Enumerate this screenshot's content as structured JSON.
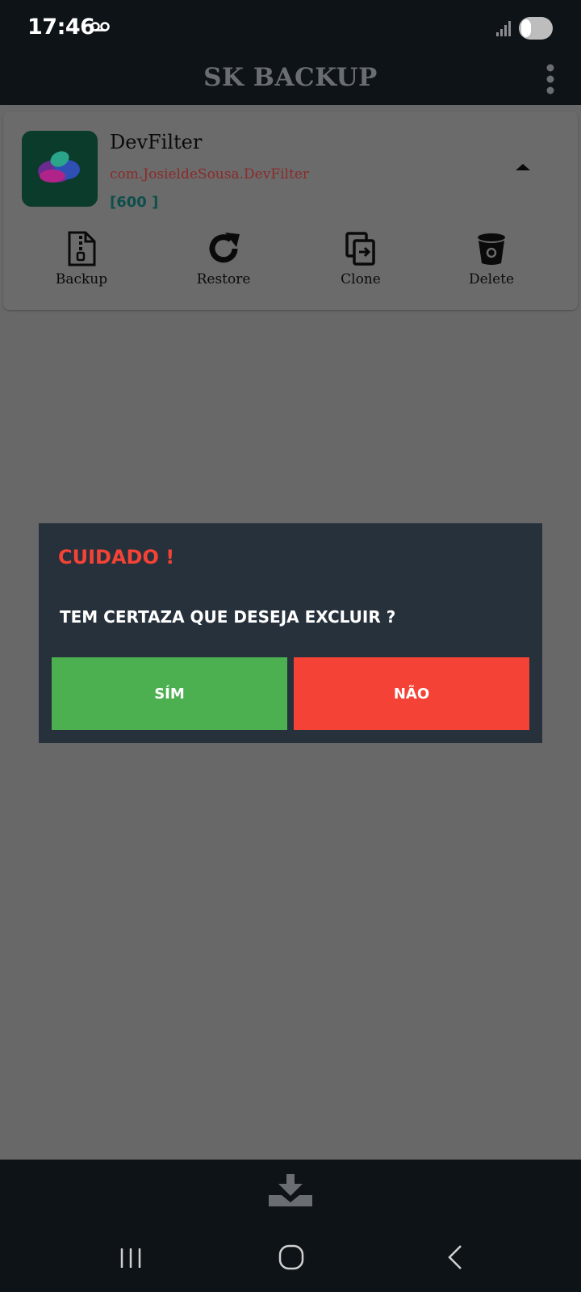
{
  "status_bar": {
    "time": "17:46",
    "icons": [
      "voicemail-icon",
      "signal-icon",
      "battery-icon"
    ]
  },
  "app_bar": {
    "title": "SK BACKUP",
    "menu_icon": "more-vert-icon"
  },
  "app_card": {
    "name": "DevFilter",
    "package": "com.JosieldeSousa.DevFilter",
    "count": "[600 ]",
    "actions": [
      {
        "label": "Backup",
        "icon": "zip-file-icon"
      },
      {
        "label": "Restore",
        "icon": "refresh-icon"
      },
      {
        "label": "Clone",
        "icon": "clone-icon"
      },
      {
        "label": "Delete",
        "icon": "trash-icon"
      }
    ]
  },
  "dialog": {
    "title": "CUIDADO !",
    "message": "TEM CERTAZA QUE DESEJA EXCLUIR ?",
    "yes_label": "SÍM",
    "no_label": "NÃO"
  },
  "bottom_bar": {
    "icon": "download-icon"
  },
  "nav_bar": {
    "icons": [
      "recents-icon",
      "home-icon",
      "back-icon"
    ]
  },
  "colors": {
    "scrim": "#686868",
    "bar": "#0e1318",
    "dialog_bg": "#27313b",
    "warning": "#f44336",
    "confirm": "#4caf50",
    "package_text": "#8b2a2a",
    "count_text": "#0f4f4b"
  }
}
